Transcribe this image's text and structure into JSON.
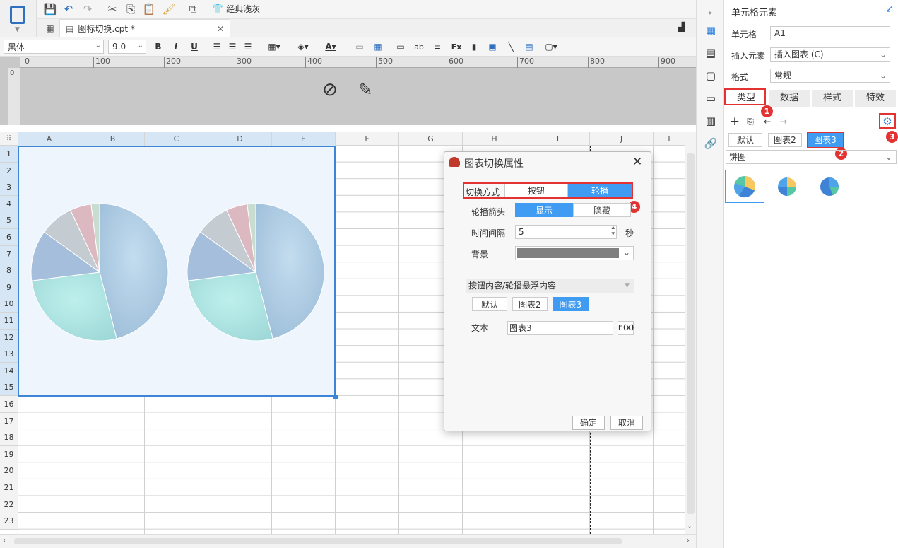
{
  "toolbar": {
    "theme_label": "经典浅灰"
  },
  "tab": {
    "title": "图标切换.cpt *"
  },
  "format": {
    "font": "黑体",
    "size": "9.0"
  },
  "ruler": {
    "ticks": [
      "0",
      "100",
      "200",
      "300",
      "400",
      "500",
      "600",
      "700",
      "800",
      "900"
    ],
    "vticks": [
      "0"
    ]
  },
  "grid": {
    "columns": [
      "A",
      "B",
      "C",
      "D",
      "E",
      "F",
      "G",
      "H",
      "I",
      "J",
      "I"
    ],
    "rows": [
      "1",
      "2",
      "3",
      "4",
      "5",
      "6",
      "7",
      "8",
      "9",
      "10",
      "11",
      "12",
      "13",
      "14",
      "15",
      "16",
      "17",
      "18",
      "19",
      "20",
      "21",
      "22",
      "23"
    ]
  },
  "right_panel": {
    "title": "单元格元素",
    "cell_label": "单元格",
    "cell_value": "A1",
    "insert_label": "插入元素",
    "insert_value": "插入图表 (C)",
    "format_label": "格式",
    "format_value": "常规",
    "tabs": [
      "类型",
      "数据",
      "样式",
      "特效"
    ],
    "chart_buttons": [
      "默认",
      "图表2",
      "图表3"
    ],
    "chart_type": "饼图",
    "badges": [
      "1",
      "2",
      "3",
      "4"
    ]
  },
  "dialog": {
    "title": "图表切换属性",
    "switch_label": "切换方式",
    "switch_opts": [
      "按钮",
      "轮播"
    ],
    "arrow_label": "轮播箭头",
    "arrow_opts": [
      "显示",
      "隐藏"
    ],
    "interval_label": "时间间隔",
    "interval_value": "5",
    "interval_unit": "秒",
    "bg_label": "背景",
    "content_label": "按钮内容/轮播悬浮内容",
    "content_buttons": [
      "默认",
      "图表2",
      "图表3"
    ],
    "text_label": "文本",
    "text_value": "图表3",
    "fx": "F(x)",
    "ok": "确定",
    "cancel": "取消"
  },
  "colors": {
    "accent": "#3f9cf2",
    "red": "#e23232",
    "selection": "#3d85d6"
  }
}
